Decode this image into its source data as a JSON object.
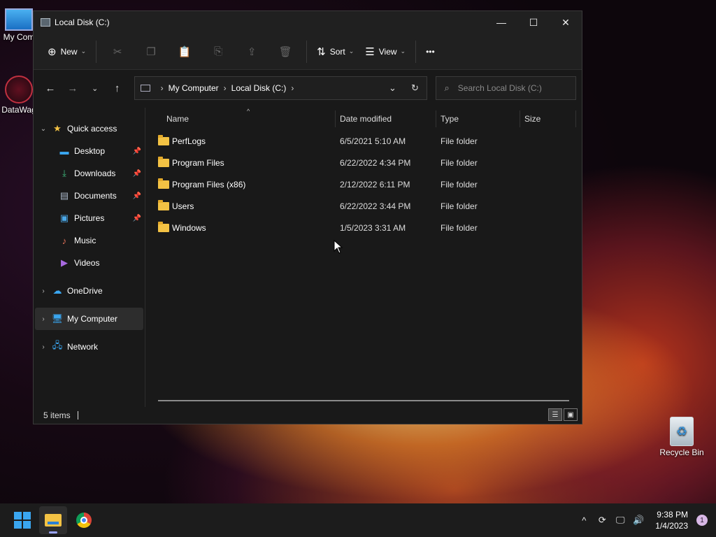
{
  "desktop": {
    "icons": [
      {
        "label": "My Com"
      },
      {
        "label": "DataWag"
      },
      {
        "label": "Recycle Bin"
      }
    ]
  },
  "window": {
    "title": "Local Disk (C:)",
    "controls": {
      "minimize": "—",
      "maximize": "☐",
      "close": "✕"
    }
  },
  "toolbar": {
    "new_label": "New",
    "sort_label": "Sort",
    "view_label": "View",
    "more_label": "•••"
  },
  "nav": {
    "breadcrumbs": [
      "My Computer",
      "Local Disk (C:)"
    ],
    "search_placeholder": "Search Local Disk (C:)"
  },
  "sidebar": {
    "quick_access": "Quick access",
    "items": [
      {
        "label": "Desktop",
        "pinned": true
      },
      {
        "label": "Downloads",
        "pinned": true
      },
      {
        "label": "Documents",
        "pinned": true
      },
      {
        "label": "Pictures",
        "pinned": true
      },
      {
        "label": "Music",
        "pinned": false
      },
      {
        "label": "Videos",
        "pinned": false
      }
    ],
    "onedrive": "OneDrive",
    "my_computer": "My Computer",
    "network": "Network"
  },
  "columns": {
    "name": "Name",
    "date": "Date modified",
    "type": "Type",
    "size": "Size"
  },
  "files": [
    {
      "name": "PerfLogs",
      "date": "6/5/2021 5:10 AM",
      "type": "File folder"
    },
    {
      "name": "Program Files",
      "date": "6/22/2022 4:34 PM",
      "type": "File folder"
    },
    {
      "name": "Program Files (x86)",
      "date": "2/12/2022 6:11 PM",
      "type": "File folder"
    },
    {
      "name": "Users",
      "date": "6/22/2022 3:44 PM",
      "type": "File folder"
    },
    {
      "name": "Windows",
      "date": "1/5/2023 3:31 AM",
      "type": "File folder"
    }
  ],
  "status": {
    "count": "5 items"
  },
  "taskbar": {
    "time": "9:38 PM",
    "date": "1/4/2023",
    "notifications": "1"
  },
  "colors": {
    "folder": "#f3c244",
    "accent": "#3aa6f0"
  }
}
